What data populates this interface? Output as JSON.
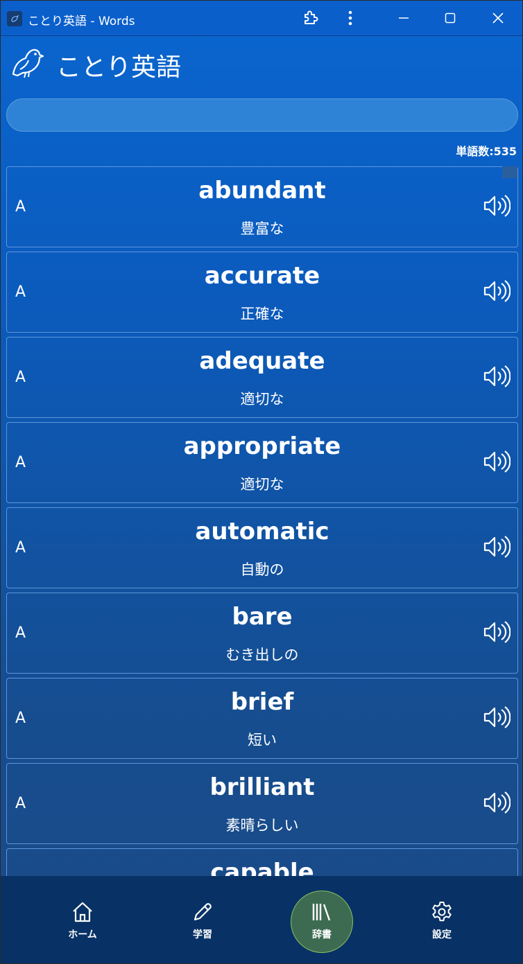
{
  "window": {
    "title": "ことり英語 - Words",
    "controls": {
      "extension_icon": "puzzle-icon",
      "more_icon": "more-vertical-icon",
      "minimize_icon": "minimize-icon",
      "maximize_icon": "maximize-icon",
      "close_icon": "close-icon"
    }
  },
  "header": {
    "logo_icon": "bird-icon",
    "app_name": "ことり英語"
  },
  "search": {
    "value": "",
    "placeholder": ""
  },
  "word_count_label": "単語数:535",
  "words": [
    {
      "level": "A",
      "word": "abundant",
      "meaning": "豊富な"
    },
    {
      "level": "A",
      "word": "accurate",
      "meaning": "正確な"
    },
    {
      "level": "A",
      "word": "adequate",
      "meaning": "適切な"
    },
    {
      "level": "A",
      "word": "appropriate",
      "meaning": "適切な"
    },
    {
      "level": "A",
      "word": "automatic",
      "meaning": "自動の"
    },
    {
      "level": "A",
      "word": "bare",
      "meaning": "むき出しの"
    },
    {
      "level": "A",
      "word": "brief",
      "meaning": "短い"
    },
    {
      "level": "A",
      "word": "brilliant",
      "meaning": "素晴らしい"
    },
    {
      "level": "",
      "word": "capable",
      "meaning": ""
    }
  ],
  "nav": {
    "items": [
      {
        "label": "ホーム",
        "icon": "home-icon",
        "active": false
      },
      {
        "label": "学習",
        "icon": "pencil-icon",
        "active": false
      },
      {
        "label": "辞書",
        "icon": "library-icon",
        "active": true
      },
      {
        "label": "設定",
        "icon": "gear-icon",
        "active": false
      }
    ]
  },
  "colors": {
    "background": "#0b5bbd",
    "nav_background": "#083265",
    "active_nav": "#3d6b52",
    "card_border": "#5e97dc"
  }
}
